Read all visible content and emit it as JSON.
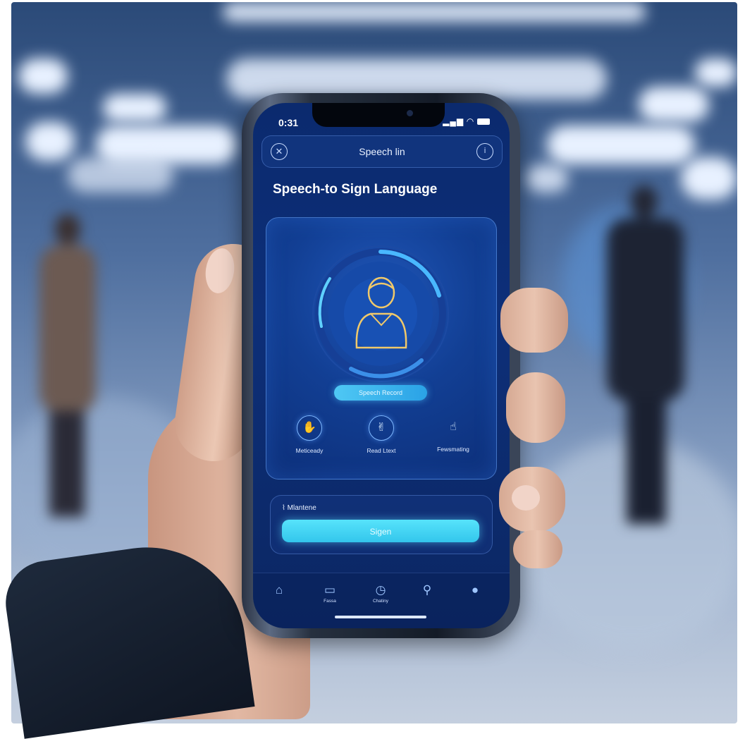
{
  "status_bar": {
    "time": "0:31",
    "icons": "❘❙❚ ● ▬"
  },
  "topbar": {
    "title": "Speech lin",
    "left_icon": "close-icon",
    "right_icon": "info-icon"
  },
  "heading": "Speech-to Sign Language",
  "avatar": {
    "icon": "person-avatar-icon"
  },
  "pill_label": "Speech Record",
  "features": [
    {
      "label": "Meticeady",
      "icon": "hand-sign-icon"
    },
    {
      "label": "Read Ltext",
      "icon": "hands-icon"
    },
    {
      "label": "Fewsmating",
      "icon": "gesture-icon"
    }
  ],
  "mic": {
    "label": "Mlantene"
  },
  "sign_button": "Sigen",
  "nav": [
    {
      "icon": "home-icon",
      "label": ""
    },
    {
      "icon": "chat-icon",
      "label": "Fassa"
    },
    {
      "icon": "history-icon",
      "label": "Chatiny"
    },
    {
      "icon": "search-icon",
      "label": ""
    },
    {
      "icon": "profile-icon",
      "label": ""
    }
  ],
  "colors": {
    "screen_bg": "#0d2f79",
    "accent": "#4fd6f4",
    "ring": "#49b8ff"
  }
}
